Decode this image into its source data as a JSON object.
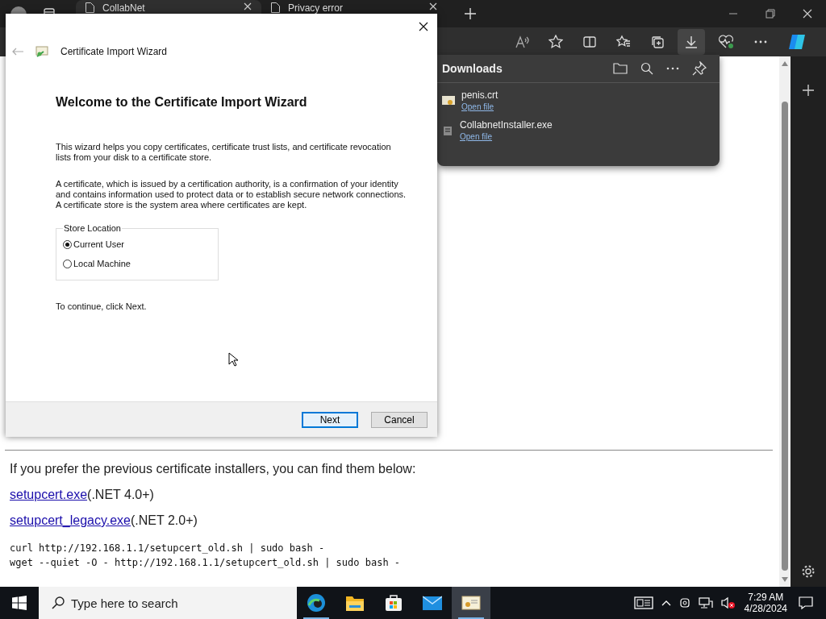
{
  "browser": {
    "tabs": [
      {
        "title": "CollabNet",
        "selected": true
      },
      {
        "title": "Privacy error",
        "selected": false
      }
    ]
  },
  "downloads": {
    "title": "Downloads",
    "items": [
      {
        "name": "penis.crt",
        "action": "Open file",
        "kind": "certificate"
      },
      {
        "name": "CollabnetInstaller.exe",
        "action": "Open file",
        "kind": "installer"
      }
    ]
  },
  "dialog": {
    "title": "Certificate Import Wizard",
    "heading": "Welcome to the Certificate Import Wizard",
    "paragraphs": [
      "This wizard helps you copy certificates, certificate trust lists, and certificate revocation lists from your disk to a certificate store.",
      "A certificate, which is issued by a certification authority, is a confirmation of your identity and contains information used to protect data or to establish secure network connections. A certificate store is the system area where certificates are kept."
    ],
    "store_location": {
      "label": "Store Location",
      "options": [
        {
          "label": "Current User",
          "selected": true
        },
        {
          "label": "Local Machine",
          "selected": false
        }
      ]
    },
    "note": "To continue, click Next.",
    "buttons": [
      {
        "label": "Next",
        "primary": true
      },
      {
        "label": "Cancel",
        "primary": false
      }
    ]
  },
  "page": {
    "intro": "If you prefer the previous certificate installers, you can find them below:",
    "links": [
      {
        "link": "setupcert.exe",
        "note": "(.NET 4.0+)"
      },
      {
        "link": "setupcert_legacy.exe",
        "note": "(.NET 2.0+)"
      }
    ],
    "code": [
      "curl http://192.168.1.1/setupcert_old.sh | sudo bash -",
      "wget --quiet -O - http://192.168.1.1/setupcert_old.sh | sudo bash -"
    ]
  },
  "taskbar": {
    "search_placeholder": "Type here to search",
    "apps": [
      {
        "kind": "edge",
        "running": true,
        "selected": false
      },
      {
        "kind": "explorer",
        "running": false,
        "selected": false
      },
      {
        "kind": "store",
        "running": false,
        "selected": false
      },
      {
        "kind": "mail",
        "running": false,
        "selected": false
      },
      {
        "kind": "certificate",
        "running": true,
        "selected": true
      }
    ],
    "time": "7:29 AM",
    "date": "4/28/2024"
  }
}
